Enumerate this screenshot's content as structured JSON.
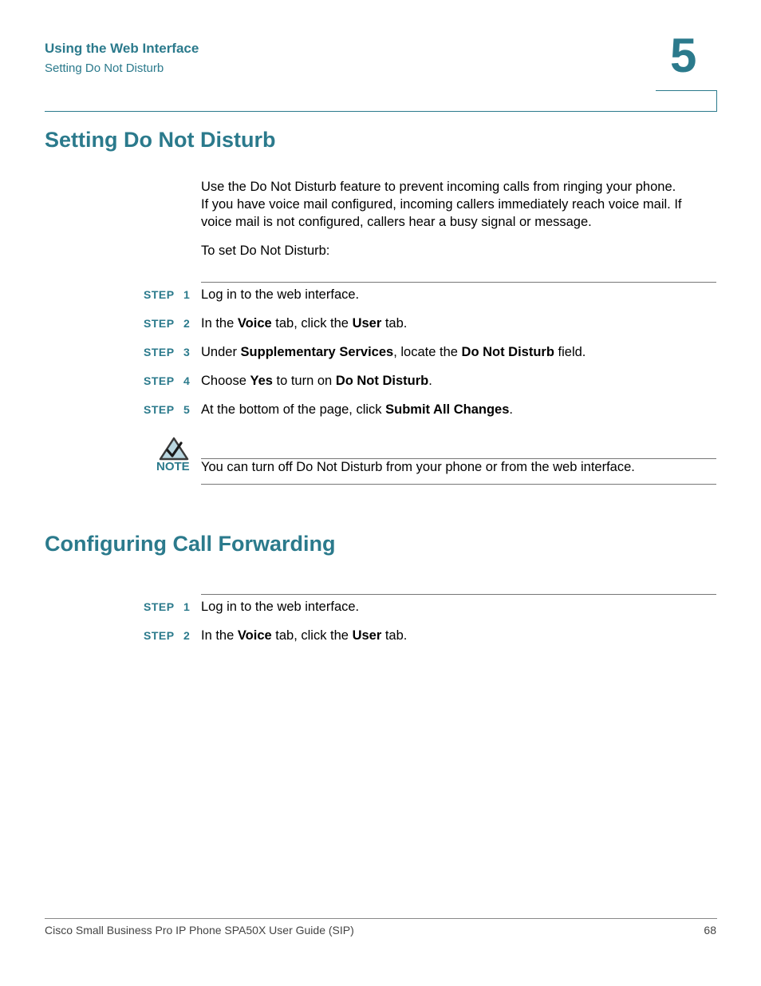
{
  "header": {
    "chapter_title": "Using the Web Interface",
    "section_title": "Setting Do Not Disturb",
    "chapter_number": "5"
  },
  "section1": {
    "heading": "Setting Do Not Disturb",
    "intro_lines": [
      "Use the Do Not Disturb feature to prevent incoming calls from ringing your phone.",
      "If you have voice mail configured, incoming callers immediately reach voice mail. If",
      "voice mail is not configured, callers hear a busy signal or message."
    ],
    "lead_in": "To set Do Not Disturb:",
    "steps": [
      {
        "label": "STEP",
        "num": "1",
        "parts": [
          {
            "t": "Log in to the web interface."
          }
        ]
      },
      {
        "label": "STEP",
        "num": "2",
        "parts": [
          {
            "t": "In the "
          },
          {
            "t": "Voice",
            "b": true
          },
          {
            "t": " tab, click the "
          },
          {
            "t": "User",
            "b": true
          },
          {
            "t": " tab."
          }
        ]
      },
      {
        "label": "STEP",
        "num": "3",
        "parts": [
          {
            "t": "Under "
          },
          {
            "t": "Supplementary Services",
            "b": true
          },
          {
            "t": ", locate the "
          },
          {
            "t": "Do Not Disturb",
            "b": true
          },
          {
            "t": " field."
          }
        ]
      },
      {
        "label": "STEP",
        "num": "4",
        "parts": [
          {
            "t": "Choose "
          },
          {
            "t": "Yes",
            "b": true
          },
          {
            "t": " to turn on "
          },
          {
            "t": "Do Not Disturb",
            "b": true
          },
          {
            "t": "."
          }
        ]
      },
      {
        "label": "STEP",
        "num": "5",
        "parts": [
          {
            "t": "At the bottom of the page, click "
          },
          {
            "t": "Submit All Changes",
            "b": true
          },
          {
            "t": "."
          }
        ]
      }
    ],
    "note": {
      "icon": "checkmark-triangle-icon",
      "label": "NOTE",
      "text": "You can turn off Do Not Disturb from your phone or from the web interface."
    }
  },
  "section2": {
    "heading": "Configuring Call Forwarding",
    "steps": [
      {
        "label": "STEP",
        "num": "1",
        "parts": [
          {
            "t": "Log in to the web interface."
          }
        ]
      },
      {
        "label": "STEP",
        "num": "2",
        "parts": [
          {
            "t": "In the "
          },
          {
            "t": "Voice",
            "b": true
          },
          {
            "t": " tab, click the "
          },
          {
            "t": "User",
            "b": true
          },
          {
            "t": " tab."
          }
        ]
      }
    ]
  },
  "footer": {
    "guide_title": "Cisco Small Business Pro IP Phone SPA50X User Guide (SIP)",
    "page_number": "68"
  },
  "colors": {
    "accent": "#2b7a8c",
    "note_icon_fill": "#b9d6e0"
  }
}
